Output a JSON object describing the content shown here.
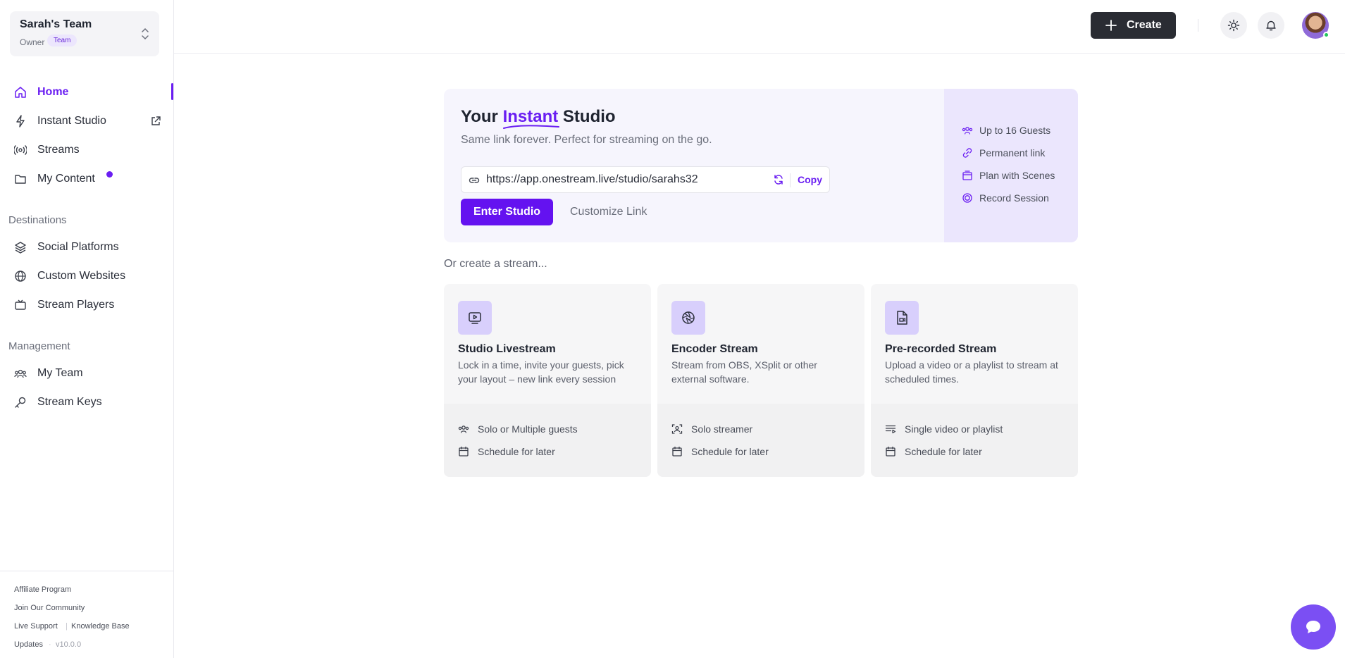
{
  "team": {
    "name": "Sarah's Team",
    "role": "Owner",
    "badge": "Team"
  },
  "nav": {
    "home": "Home",
    "instant_studio": "Instant Studio",
    "streams": "Streams",
    "my_content": "My Content"
  },
  "sections": {
    "destinations": "Destinations",
    "management": "Management"
  },
  "destinations": {
    "social": "Social Platforms",
    "custom": "Custom Websites",
    "players": "Stream Players"
  },
  "management": {
    "team": "My Team",
    "keys": "Stream Keys"
  },
  "footer": {
    "affiliate": "Affiliate Program",
    "community": "Join Our Community",
    "live_support": "Live Support",
    "knowledge_base": "Knowledge Base",
    "updates": "Updates",
    "version": "v10.0.0"
  },
  "header": {
    "create_label": "Create"
  },
  "studio": {
    "title_prefix": "Your",
    "title_highlight": "Instant",
    "title_suffix": "Studio",
    "subtitle": "Same link forever. Perfect for streaming on the go.",
    "url": "https://app.onestream.live/studio/sarahs32",
    "copy_label": "Copy",
    "enter_label": "Enter Studio",
    "customize_label": "Customize Link",
    "features": [
      "Up to 16 Guests",
      "Permanent link",
      "Plan with Scenes",
      "Record Session"
    ]
  },
  "or_create": "Or create a stream...",
  "cards": [
    {
      "title": "Studio Livestream",
      "desc": "Lock in a time, invite your guests, pick your layout – new link every session",
      "items": [
        "Solo or Multiple guests",
        "Schedule for later"
      ]
    },
    {
      "title": "Encoder Stream",
      "desc": "Stream from OBS, XSplit or other external software.",
      "items": [
        "Solo streamer",
        "Schedule for later"
      ]
    },
    {
      "title": "Pre-recorded Stream",
      "desc": "Upload a video or a playlist to stream at scheduled times.",
      "items": [
        "Single video or playlist",
        "Schedule for later"
      ]
    }
  ],
  "colors": {
    "accent": "#6a1ef2",
    "primary_button": "#6412f0",
    "dark_button": "#2a2c33"
  }
}
